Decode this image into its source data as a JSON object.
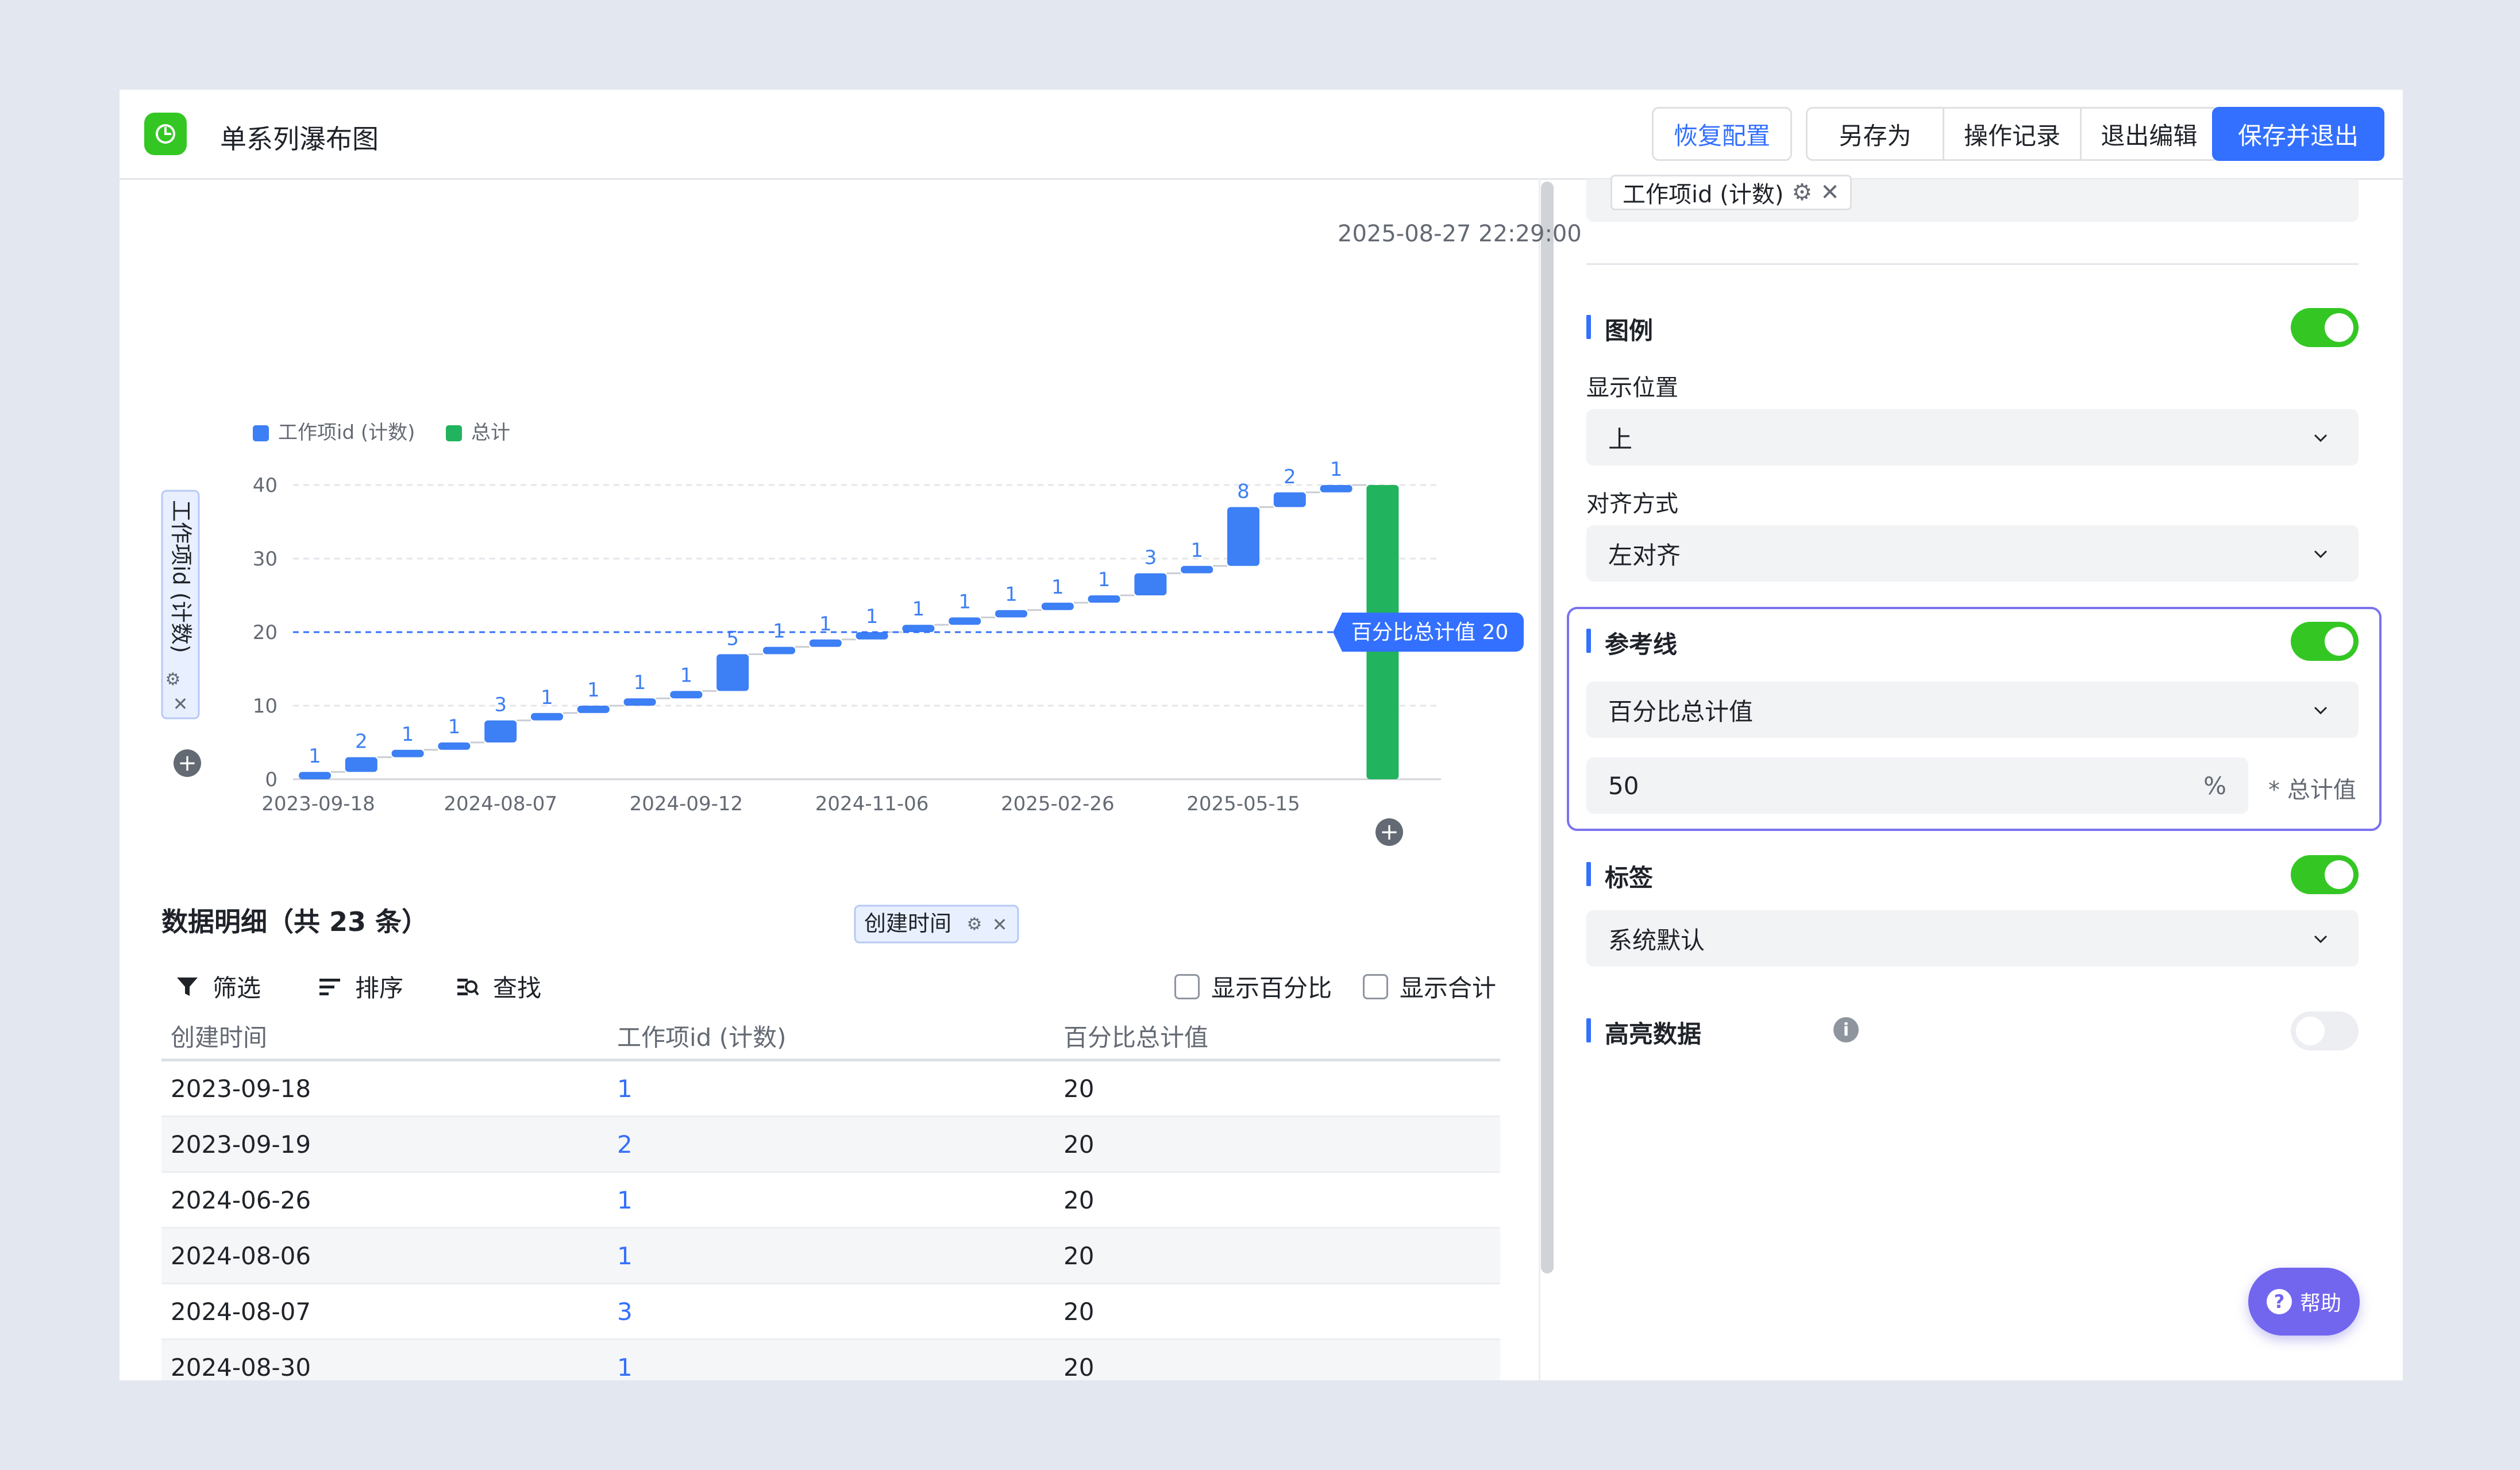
{
  "header": {
    "title": "单系列瀑布图",
    "restore_label": "恢复配置",
    "save_as_label": "另存为",
    "history_label": "操作记录",
    "exit_label": "退出编辑",
    "save_exit_label": "保存并退出"
  },
  "timestamp": "2025-08-27 22:29:00",
  "chart_data": {
    "type": "bar",
    "subtype": "waterfall",
    "legend": [
      "工作项id (计数)",
      "总计"
    ],
    "legend_position": "top-left",
    "ylabel": "工作项id (计数)",
    "xlabel": "创建时间",
    "ylim": [
      0,
      40
    ],
    "yticks": [
      "0",
      "10",
      "20",
      "30",
      "40"
    ],
    "xtick_labels": [
      "2023-09-18",
      "2024-08-07",
      "2024-09-12",
      "2024-11-06",
      "2025-02-26",
      "2025-05-15"
    ],
    "increments": [
      1,
      2,
      1,
      1,
      3,
      1,
      1,
      1,
      1,
      5,
      1,
      1,
      1,
      1,
      1,
      1,
      1,
      1,
      3,
      1,
      8,
      2,
      1
    ],
    "total": 40,
    "reference_line": {
      "label": "百分比总计值 20",
      "value": 20
    },
    "colors": {
      "increment": "#3d7ff4",
      "total": "#21b35d",
      "reference": "#3370ff"
    },
    "grid": true
  },
  "x_axis_chip": "创建时间",
  "detail": {
    "title": "数据明细（共 23 条）",
    "filter_label": "筛选",
    "sort_label": "排序",
    "find_label": "查找",
    "show_percent_label": "显示百分比",
    "show_total_label": "显示合计",
    "columns": [
      "创建时间",
      "工作项id (计数)",
      "百分比总计值"
    ],
    "rows": [
      [
        "2023-09-18",
        "1",
        "20"
      ],
      [
        "2023-09-19",
        "2",
        "20"
      ],
      [
        "2024-06-26",
        "1",
        "20"
      ],
      [
        "2024-08-06",
        "1",
        "20"
      ],
      [
        "2024-08-07",
        "3",
        "20"
      ],
      [
        "2024-08-30",
        "1",
        "20"
      ]
    ]
  },
  "panel": {
    "field_chip": "工作项id (计数)",
    "legend_label": "图例",
    "legend_enabled": true,
    "position_label": "显示位置",
    "position_value": "上",
    "align_label": "对齐方式",
    "align_value": "左对齐",
    "refline_label": "参考线",
    "refline_enabled": true,
    "refline_type": "百分比总计值",
    "refline_percent": "50",
    "refline_unit": "%",
    "refline_suffix": "* 总计值",
    "labels_label": "标签",
    "labels_enabled": true,
    "labels_value": "系统默认",
    "highlight_label": "高亮数据",
    "highlight_enabled": false
  },
  "help_label": "帮助"
}
